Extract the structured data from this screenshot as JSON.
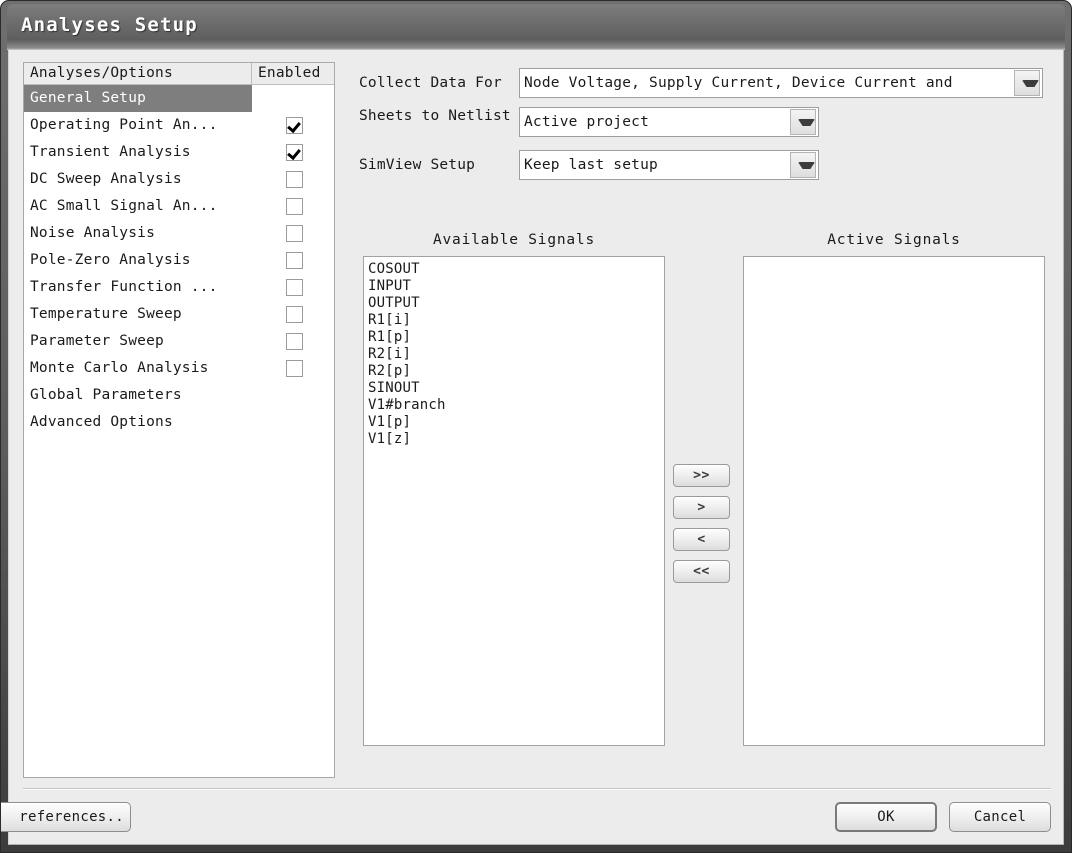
{
  "window": {
    "title": "Analyses Setup"
  },
  "analyses_list": {
    "headers": {
      "name": "Analyses/Options",
      "enabled": "Enabled"
    },
    "rows": [
      {
        "label": "General Setup",
        "selected": true,
        "has_checkbox": false,
        "checked": false
      },
      {
        "label": "Operating Point An...",
        "selected": false,
        "has_checkbox": true,
        "checked": true
      },
      {
        "label": "Transient Analysis",
        "selected": false,
        "has_checkbox": true,
        "checked": true
      },
      {
        "label": "DC Sweep Analysis",
        "selected": false,
        "has_checkbox": true,
        "checked": false
      },
      {
        "label": "AC Small Signal An...",
        "selected": false,
        "has_checkbox": true,
        "checked": false
      },
      {
        "label": "Noise Analysis",
        "selected": false,
        "has_checkbox": true,
        "checked": false
      },
      {
        "label": "Pole-Zero Analysis",
        "selected": false,
        "has_checkbox": true,
        "checked": false
      },
      {
        "label": "Transfer Function ...",
        "selected": false,
        "has_checkbox": true,
        "checked": false
      },
      {
        "label": "Temperature Sweep",
        "selected": false,
        "has_checkbox": true,
        "checked": false
      },
      {
        "label": "Parameter Sweep",
        "selected": false,
        "has_checkbox": true,
        "checked": false
      },
      {
        "label": "Monte Carlo Analysis",
        "selected": false,
        "has_checkbox": true,
        "checked": false
      },
      {
        "label": "Global Parameters",
        "selected": false,
        "has_checkbox": false,
        "checked": false
      },
      {
        "label": "Advanced Options",
        "selected": false,
        "has_checkbox": false,
        "checked": false
      }
    ]
  },
  "general_setup": {
    "collect_data": {
      "label": "Collect Data For",
      "value": "Node Voltage, Supply Current, Device Current and",
      "arrow_icon": "chevron-down-icon"
    },
    "sheets_to_netlist": {
      "label": "Sheets to Netlist",
      "value": "Active project",
      "arrow_icon": "chevron-down-icon"
    },
    "simview_setup": {
      "label": "SimView Setup",
      "value": "Keep last setup",
      "arrow_icon": "chevron-down-icon"
    },
    "available_signals": {
      "title": "Available Signals",
      "items": [
        "COSOUT",
        "INPUT",
        "OUTPUT",
        "R1[i]",
        "R1[p]",
        "R2[i]",
        "R2[p]",
        "SINOUT",
        "V1#branch",
        "V1[p]",
        "V1[z]"
      ]
    },
    "active_signals": {
      "title": "Active Signals",
      "items": []
    },
    "transfer_buttons": [
      {
        "label": ">>",
        "name": "add-all-button"
      },
      {
        "label": ">",
        "name": "add-selected-button"
      },
      {
        "label": "<",
        "name": "remove-selected-button"
      },
      {
        "label": "<<",
        "name": "remove-all-button"
      }
    ]
  },
  "footer": {
    "preferences_label": "references..",
    "ok_label": "OK",
    "cancel_label": "Cancel"
  },
  "colors": {
    "dialog_background": "#ececec",
    "titlebar_gradient_top": "#7d7d7d",
    "titlebar_gradient_bottom": "#5e5e5e",
    "selection_background": "#7e7e7e",
    "selection_text": "#ffffff",
    "listbox_background": "#ffffff",
    "border": "#a9a9a9",
    "text": "#1a1a1a"
  }
}
